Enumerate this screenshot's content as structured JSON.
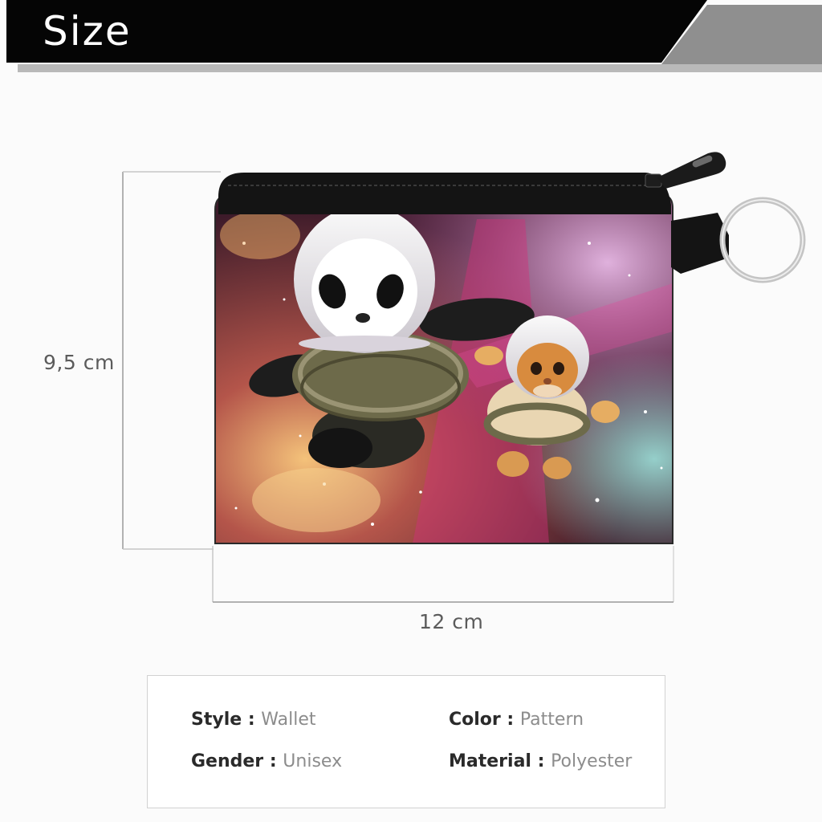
{
  "banner": {
    "title": "Size"
  },
  "dimensions": {
    "height": "9,5 cm",
    "width": "12 cm"
  },
  "specs": [
    {
      "label": "Style",
      "value": "Wallet"
    },
    {
      "label": "Color",
      "value": "Pattern"
    },
    {
      "label": "Gender",
      "value": "Unisex"
    },
    {
      "label": "Material",
      "value": "Polyester"
    }
  ],
  "colors": {
    "banner_black": "#050505",
    "banner_gray": "#8a8a8a",
    "label_gray": "#5b5b5b",
    "value_gray": "#8c8c8c"
  }
}
